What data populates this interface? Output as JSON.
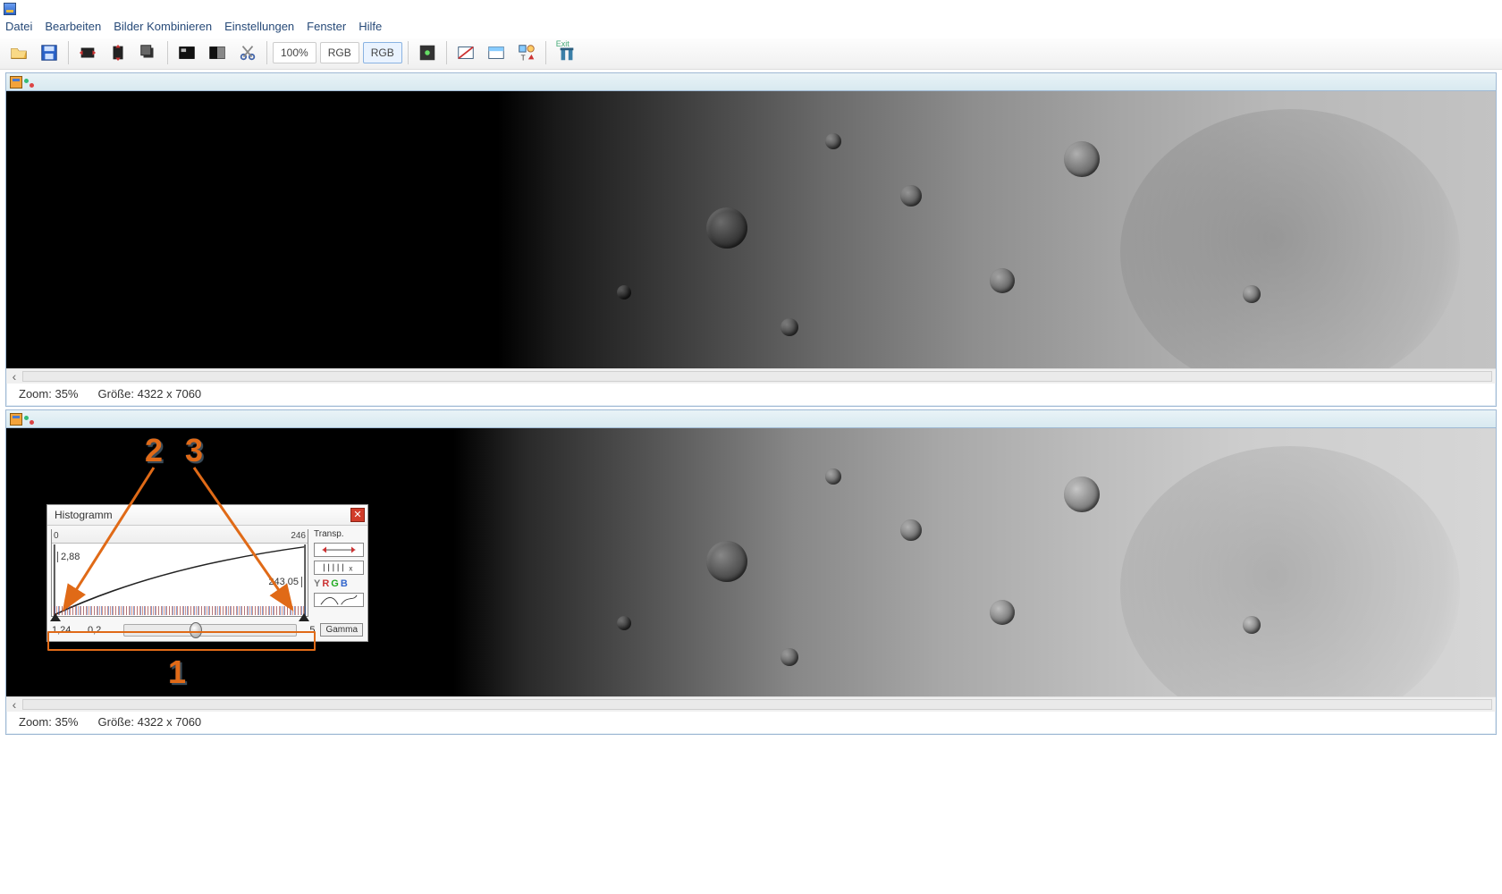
{
  "app": {
    "title": ""
  },
  "menu": {
    "file": "Datei",
    "edit": "Bearbeiten",
    "combine": "Bilder Kombinieren",
    "settings": "Einstellungen",
    "window": "Fenster",
    "help": "Hilfe"
  },
  "toolbar": {
    "zoom_text": "100%",
    "rgb1": "RGB",
    "rgb2": "RGB",
    "exit": "Exit"
  },
  "pane1": {
    "status_zoom_label": "Zoom:",
    "status_zoom_value": "35%",
    "status_size_label": "Größe:",
    "status_size_value": "4322 x 7060"
  },
  "pane2": {
    "status_zoom_label": "Zoom:",
    "status_zoom_value": "35%",
    "status_size_label": "Größe:",
    "status_size_value": "4322 x 7060"
  },
  "histogram": {
    "title": "Histogramm",
    "axis_min": "0",
    "axis_max": "246",
    "black_value": "2,88",
    "white_value": "243,05",
    "side_transp": "Transp.",
    "yrgb": {
      "y": "Y",
      "r": "R",
      "g": "G",
      "b": "B"
    },
    "gamma_value": "1,24",
    "gamma_min": "0,2",
    "gamma_max": "5",
    "gamma_button": "Gamma"
  },
  "annotations": {
    "n1": "1",
    "n2": "2",
    "n3": "3"
  },
  "chart_data": {
    "type": "line",
    "title": "Histogramm",
    "xlabel": "",
    "ylabel": "",
    "xlim": [
      0,
      246
    ],
    "black_point": 2.88,
    "white_point": 243.05,
    "gamma": 1.24,
    "gamma_range": [
      0.2,
      5
    ],
    "curve_points_x": [
      0,
      30,
      60,
      90,
      120,
      150,
      180,
      210,
      246
    ],
    "curve_points_y": [
      0,
      0.28,
      0.45,
      0.58,
      0.69,
      0.79,
      0.87,
      0.94,
      1.0
    ],
    "note": "curve_points_y are normalised output values of a gamma≈1.24 tone curve; histogram bar heights along the x axis are near-zero across the range with small coloured (R/G/B) spikes near the low end."
  }
}
